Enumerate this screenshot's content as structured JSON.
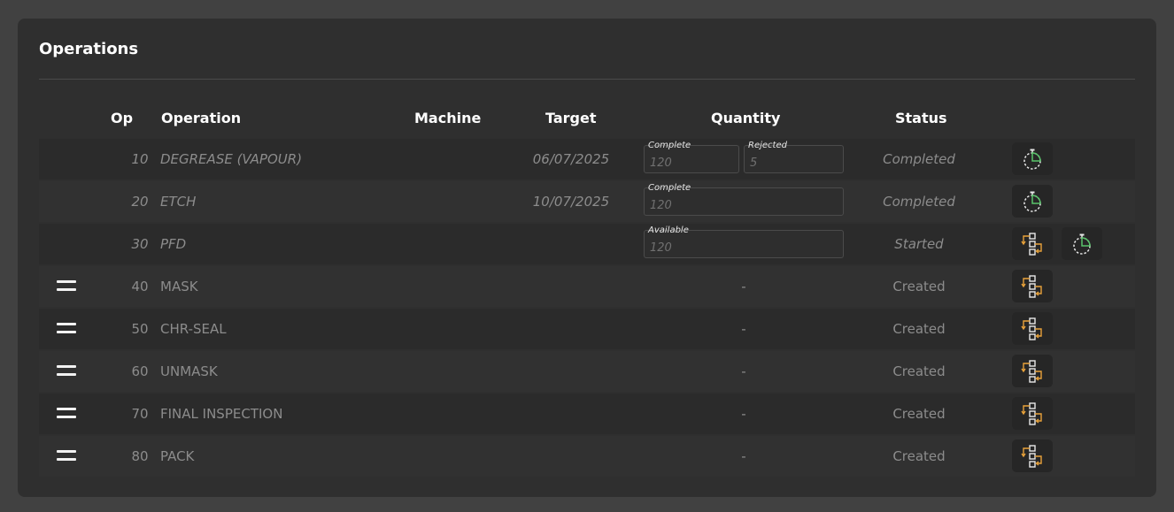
{
  "card": {
    "title": "Operations"
  },
  "columns": {
    "op": "Op",
    "operation": "Operation",
    "machine": "Machine",
    "target": "Target",
    "quantity": "Quantity",
    "status": "Status"
  },
  "rows": [
    {
      "op": "10",
      "operation": "DEGREASE (VAPOUR)",
      "target": "06/07/2025",
      "status": "Completed",
      "quantity": {
        "complete_label": "Complete",
        "complete_value": "120",
        "rejected_label": "Rejected",
        "rejected_value": "5"
      },
      "actions": [
        "timer-icon"
      ]
    },
    {
      "op": "20",
      "operation": "ETCH",
      "target": "10/07/2025",
      "status": "Completed",
      "quantity": {
        "complete_label": "Complete",
        "complete_value": "120"
      },
      "actions": [
        "timer-icon"
      ]
    },
    {
      "op": "30",
      "operation": "PFD",
      "target": "",
      "status": "Started",
      "quantity": {
        "available_label": "Available",
        "available_value": "120"
      },
      "actions": [
        "workflow-icon",
        "timer-icon"
      ]
    },
    {
      "op": "40",
      "operation": "MASK",
      "quantity_text": "-",
      "status": "Created",
      "actions": [
        "workflow-icon"
      ]
    },
    {
      "op": "50",
      "operation": "CHR-SEAL",
      "quantity_text": "-",
      "status": "Created",
      "actions": [
        "workflow-icon"
      ]
    },
    {
      "op": "60",
      "operation": "UNMASK",
      "quantity_text": "-",
      "status": "Created",
      "actions": [
        "workflow-icon"
      ]
    },
    {
      "op": "70",
      "operation": "FINAL INSPECTION",
      "quantity_text": "-",
      "status": "Created",
      "actions": [
        "workflow-icon"
      ]
    },
    {
      "op": "80",
      "operation": "PACK",
      "quantity_text": "-",
      "status": "Created",
      "actions": [
        "workflow-icon"
      ]
    }
  ],
  "colors": {
    "accent_orange": "#e8a23a",
    "timer_green": "#59c46a"
  }
}
